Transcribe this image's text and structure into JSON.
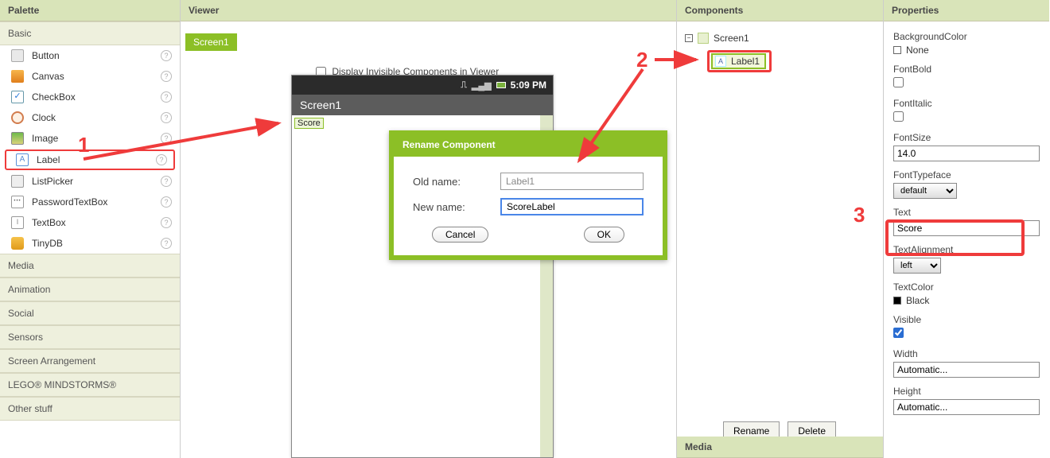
{
  "panels": {
    "palette": "Palette",
    "viewer": "Viewer",
    "components": "Components",
    "properties": "Properties"
  },
  "palette_groups": {
    "basic": "Basic",
    "media": "Media",
    "animation": "Animation",
    "social": "Social",
    "sensors": "Sensors",
    "screen_arr": "Screen Arrangement",
    "lego": "LEGO® MINDSTORMS®",
    "other": "Other stuff"
  },
  "palette_items": {
    "button": "Button",
    "canvas": "Canvas",
    "checkbox": "CheckBox",
    "clock": "Clock",
    "image": "Image",
    "label": "Label",
    "listpicker": "ListPicker",
    "passwordtextbox": "PasswordTextBox",
    "textbox": "TextBox",
    "tinydb": "TinyDB"
  },
  "viewer": {
    "screen_button": "Screen1",
    "display_inv": "Display Invisible Components in Viewer",
    "status_time": "5:09 PM",
    "phone_title": "Screen1",
    "score_label": "Score"
  },
  "dialog": {
    "title": "Rename Component",
    "old_name_label": "Old name:",
    "new_name_label": "New name:",
    "old_name": "Label1",
    "new_name": "ScoreLabel",
    "cancel": "Cancel",
    "ok": "OK"
  },
  "components": {
    "screen1": "Screen1",
    "label1": "Label1",
    "rename": "Rename",
    "delete": "Delete",
    "media": "Media"
  },
  "properties": {
    "backgroundcolor": "BackgroundColor",
    "none": "None",
    "fontbold": "FontBold",
    "fontitalic": "FontItalic",
    "fontsize": "FontSize",
    "fontsize_val": "14.0",
    "fonttypeface": "FontTypeface",
    "fonttypeface_val": "default",
    "text": "Text",
    "text_val": "Score",
    "textalign": "TextAlignment",
    "textalign_val": "left",
    "textcolor": "TextColor",
    "textcolor_val": "Black",
    "visible": "Visible",
    "width": "Width",
    "width_val": "Automatic...",
    "height": "Height",
    "height_val": "Automatic..."
  },
  "annotations": {
    "a1": "1",
    "a2": "2",
    "a3": "3"
  }
}
